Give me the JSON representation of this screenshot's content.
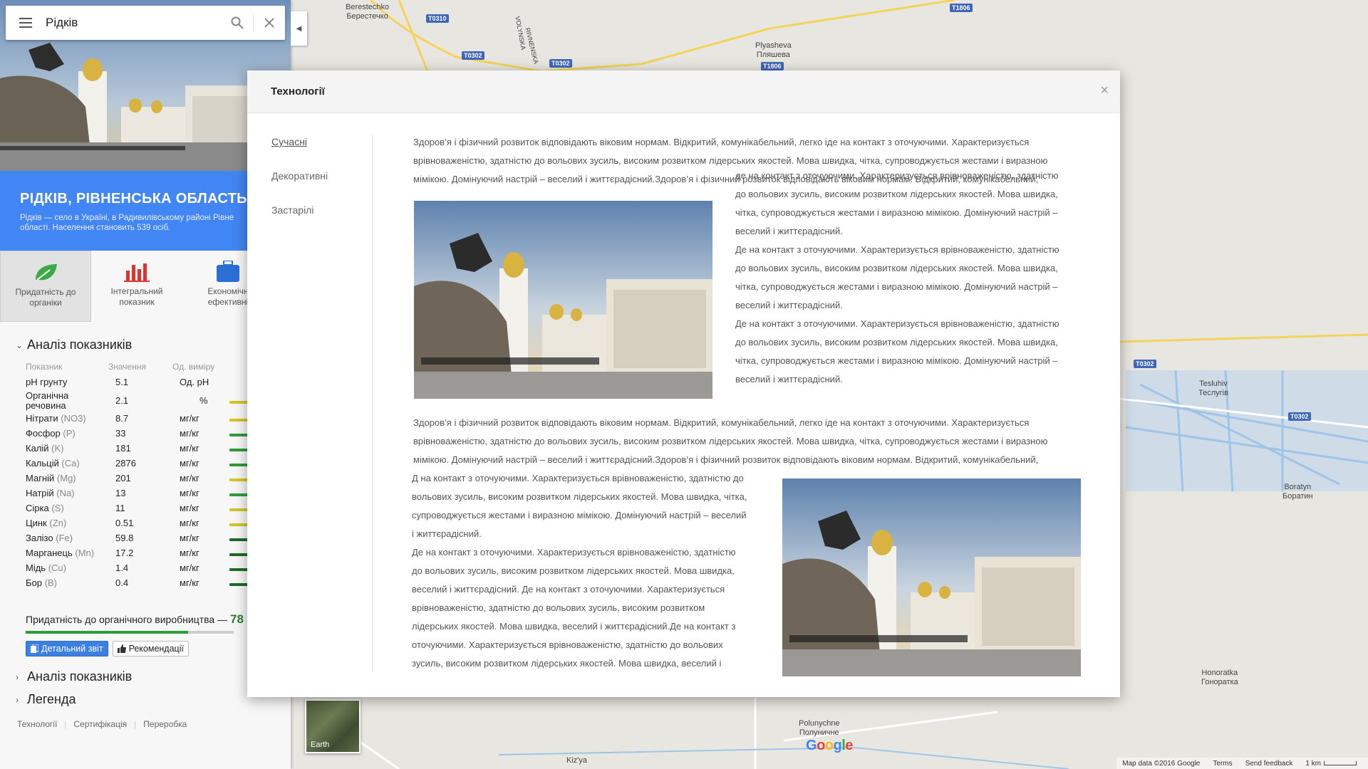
{
  "colors": {
    "accent": "#4285f4",
    "green": "#2e9c3a",
    "yellow": "#d4c62a",
    "darkgreen": "#1f6b2a"
  },
  "search": {
    "value": "Рідків"
  },
  "place": {
    "title": "РІДКІВ, РІВНЕНСЬКА ОБЛАСТЬ",
    "desc_line1": "Рідків — село в Україні, в Радивилівському районі Рівне",
    "desc_line2": "області. Населення становить 539 осіб."
  },
  "actions": [
    {
      "label1": "Придатність до",
      "label2": "органіки",
      "icon": "leaf-icon"
    },
    {
      "label1": "Інтегральний",
      "label2": "показник",
      "icon": "bar-chart-icon"
    },
    {
      "label1": "Економічн",
      "label2": "ефективні",
      "icon": "briefcase-icon"
    }
  ],
  "analysis": {
    "heading": "Аналіз показників",
    "columns": [
      "Показник",
      "Значення",
      "Од. виміру"
    ],
    "rows": [
      {
        "name": "pH грунту",
        "sym": "",
        "value": "5.1",
        "unit": "Од. pH",
        "bar": "none"
      },
      {
        "name": "Органічна речовина",
        "sym": "",
        "value": "2.1",
        "unit": "%",
        "bar": "yellow"
      },
      {
        "name": "Нітрати",
        "sym": "(NO3)",
        "value": "8.7",
        "unit": "мг/кг",
        "bar": "yellow"
      },
      {
        "name": "Фосфор",
        "sym": "(P)",
        "value": "33",
        "unit": "мг/кг",
        "bar": "green"
      },
      {
        "name": "Калій",
        "sym": "(K)",
        "value": "181",
        "unit": "мг/кг",
        "bar": "green"
      },
      {
        "name": "Кальцій",
        "sym": "(Ca)",
        "value": "2876",
        "unit": "мг/кг",
        "bar": "green"
      },
      {
        "name": "Магній",
        "sym": "(Mg)",
        "value": "201",
        "unit": "мг/кг",
        "bar": "yellow"
      },
      {
        "name": "Натрій",
        "sym": "(Na)",
        "value": "13",
        "unit": "мг/кг",
        "bar": "green"
      },
      {
        "name": "Сірка",
        "sym": "(S)",
        "value": "11",
        "unit": "мг/кг",
        "bar": "yellow"
      },
      {
        "name": "Цинк",
        "sym": "(Zn)",
        "value": "0.51",
        "unit": "мг/кг",
        "bar": "yellow"
      },
      {
        "name": "Залізо",
        "sym": "(Fe)",
        "value": "59.8",
        "unit": "мг/кг",
        "bar": "darkgreen"
      },
      {
        "name": "Марганець",
        "sym": "(Mn)",
        "value": "17.2",
        "unit": "мг/кг",
        "bar": "darkgreen"
      },
      {
        "name": "Мідь",
        "sym": "(Cu)",
        "value": "1.4",
        "unit": "мг/кг",
        "bar": "darkgreen"
      },
      {
        "name": "Бор",
        "sym": "(B)",
        "value": "0.4",
        "unit": "мг/кг",
        "bar": "darkgreen"
      }
    ],
    "suitability_label": "Придатність до органічного виробництва —",
    "suitability_value": "78",
    "suitability_fraction": 0.78,
    "detail_button": "Детальний звіт",
    "recommend_button": "Рекомендації"
  },
  "collapsed_sections": [
    "Аналіз показників",
    "Легенда"
  ],
  "footer_links": [
    "Технології",
    "Сертифікація",
    "Переробка"
  ],
  "modal": {
    "title": "Технології",
    "nav": [
      "Сучасні",
      "Декоративні",
      "Застарілі"
    ],
    "intro_lines": [
      "Здоров’я і фізичний розвиток відповідають віковим нормам. Відкритий, комунікабельний, легко іде на контакт з оточуючими. Характеризується",
      "врівноваженістю, здатністю до вольових зусиль, високим розвитком лідерських якостей. Мова швидка, чітка, супроводжується жестами і виразною",
      "мімікою. Домінуючий настрій – веселий і життєрадісний.Здоров’я і фізичний розвиток відповідають віковим нормам. Відкритий, комунікабельний,"
    ],
    "right_lines": [
      "де на контакт з оточуючими. Характеризується врівноваженістю, здатністю",
      "до вольових зусиль, високим розвитком лідерських якостей. Мова швидка,",
      "чітка, супроводжується жестами і виразною мімікою. Домінуючий настрій –",
      "веселий і життєрадісний.",
      "Де на контакт з оточуючими. Характеризується врівноваженістю, здатністю",
      "до вольових зусиль, високим розвитком лідерських якостей. Мова швидка,",
      "чітка, супроводжується жестами і виразною мімікою. Домінуючий настрій –",
      "веселий і життєрадісний.",
      "Де на контакт з оточуючими. Характеризується врівноваженістю, здатністю",
      "до вольових зусиль, високим розвитком лідерських якостей. Мова швидка,",
      "чітка, супроводжується жестами і виразною мімікою. Домінуючий настрій –",
      "веселий і життєрадісний."
    ],
    "middle_lines": [
      "Здоров’я і фізичний розвиток відповідають віковим нормам. Відкритий, комунікабельний, легко іде на контакт з оточуючими. Характеризується",
      "врівноваженістю, здатністю до вольових зусиль, високим розвитком лідерських якостей. Мова швидка, чітка, супроводжується жестами і виразною",
      "мімікою. Домінуючий настрій – веселий і життєрадісний.Здоров’я і фізичний розвиток відповідають віковим нормам. Відкритий, комунікабельний,"
    ],
    "left_lines": [
      "Д на контакт з оточуючими. Характеризується врівноваженістю, здатністю до",
      "вольових зусиль, високим розвитком лідерських якостей. Мова швидка, чітка,",
      "супроводжується жестами і виразною мімікою. Домінуючий настрій – веселий",
      "і життєрадісний.",
      "Де на контакт з оточуючими. Характеризується врівноваженістю, здатністю",
      "до вольових зусиль, високим розвитком лідерських якостей. Мова швидка,",
      "веселий і життєрадісний. Де на контакт з оточуючими. Характеризується",
      "врівноваженістю, здатністю до вольових зусиль, високим розвитком",
      "лідерських якостей. Мова швидка, веселий і життєрадісний.Де на контакт з",
      "оточуючими. Характеризується врівноваженістю, здатністю до вольових",
      "зусиль, високим розвитком лідерських якостей. Мова швидка, веселий і"
    ]
  },
  "map": {
    "places": [
      {
        "key": "berestechko",
        "lat": "Berestechko",
        "cyr": "Берестечко"
      },
      {
        "key": "plyasheva",
        "lat": "Plyasheva",
        "cyr": "Пляшева"
      },
      {
        "key": "tesluhiv",
        "lat": "Tesluhiv",
        "cyr": "Теслугів"
      },
      {
        "key": "boratyn",
        "lat": "Boratyn",
        "cyr": "Боратин"
      },
      {
        "key": "honoratka",
        "lat": "Honoratka",
        "cyr": "Гоноратка"
      },
      {
        "key": "polunychne",
        "lat": "Polunychne",
        "cyr": "Полуничне"
      },
      {
        "key": "kizya",
        "lat": "Kiz'ya",
        "cyr": ""
      }
    ],
    "roads": [
      "T0310",
      "T0302",
      "T0302",
      "T1806",
      "T1806",
      "T0302",
      "T0302"
    ],
    "street_labels": [
      "VOLYNSKA",
      "RIVNENSKA"
    ],
    "earth_label": "Earth",
    "attribution": "Map data ©2016 Google",
    "terms": "Terms",
    "feedback": "Send feedback",
    "scale": "1 km"
  }
}
